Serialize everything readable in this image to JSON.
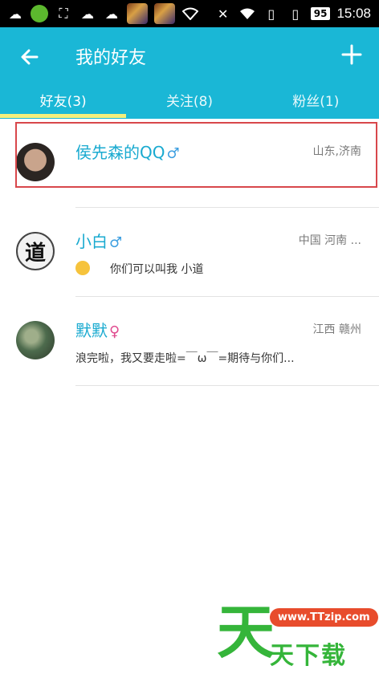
{
  "status_bar": {
    "time": "15:08",
    "battery": "95"
  },
  "header": {
    "title": "我的好友",
    "back_icon": "arrow-left-icon",
    "add_icon": "plus-icon"
  },
  "tabs": [
    {
      "label": "好友(3)",
      "active": true
    },
    {
      "label": "关注(8)",
      "active": false
    },
    {
      "label": "粉丝(1)",
      "active": false
    }
  ],
  "friends": [
    {
      "name": "侯先森的QQ",
      "gender": "♂",
      "location": "山东,济南",
      "signature": ""
    },
    {
      "name": "小白",
      "gender": "♂",
      "location": "中国 河南 ...",
      "signature": "你们可以叫我  小道"
    },
    {
      "name": "默默",
      "gender": "♀",
      "location": "江西 赣州",
      "signature": "浪完啦，我又要走啦=￣ω￣=期待与你们..."
    }
  ],
  "avatar_2_text": "道",
  "watermark": {
    "big": "天",
    "url": "www.TTzip.com",
    "text": "天下载"
  },
  "colors": {
    "header": "#1ab7d6",
    "name": "#19aad0",
    "indicator": "#f3ef7c",
    "highlight": "#d8474b"
  }
}
